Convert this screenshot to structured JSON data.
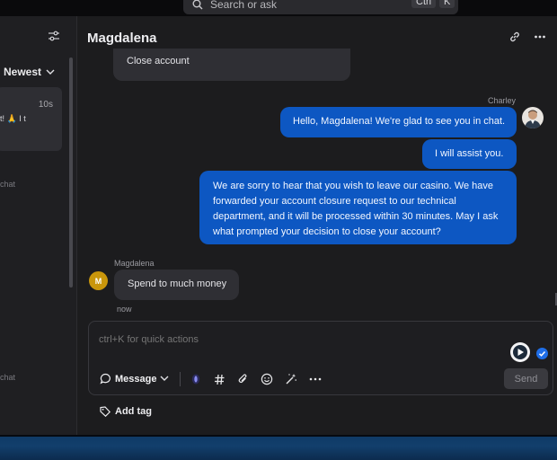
{
  "search": {
    "placeholder": "Search or ask",
    "shortcut_ctrl": "Ctrl",
    "shortcut_key": "K"
  },
  "sidebar": {
    "sort_label": "Newest",
    "conversation": {
      "time": "10s",
      "snippet": "t! 🙏 I t"
    },
    "label_1": "chat",
    "label_2": "chat"
  },
  "chat": {
    "title": "Magdalena",
    "messages": [
      {
        "text": "Close account"
      },
      {
        "sender": "Charley",
        "text": "Hello, Magdalena! We're glad to see you in chat."
      },
      {
        "text": "I will assist you."
      },
      {
        "text": "We are sorry to hear that you wish to leave our casino. We have forwarded your account closure request to our technical department, and it will be processed within 30 minutes. May I ask what prompted your decision to close your account?"
      },
      {
        "sender": "Magdalena",
        "avatar_initial": "M",
        "text": "Spend to much money",
        "time": "now"
      }
    ]
  },
  "composer": {
    "placeholder": "ctrl+K for quick actions",
    "message_type": "Message",
    "send_label": "Send",
    "add_tag_label": "Add tag"
  },
  "colors": {
    "accent": "#0d57c2",
    "background": "#1c1c1e",
    "incoming_bubble": "#2f2f34",
    "avatar_m": "#c9960b"
  }
}
